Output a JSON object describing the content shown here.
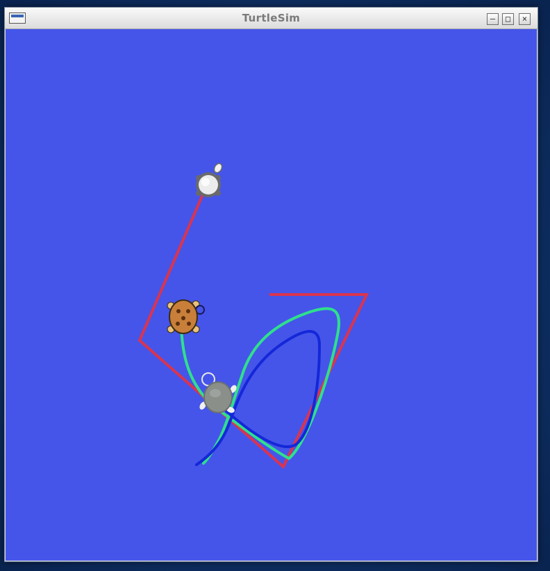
{
  "window": {
    "title": "TurtleSim",
    "controls": {
      "minimize_icon": "minimize-icon",
      "maximize_icon": "maximize-icon",
      "close_icon": "close-icon"
    }
  },
  "canvas": {
    "background_color": "#4555ea",
    "trail_colors": {
      "red": "#d9344f",
      "green": "#2fe08c",
      "blue": "#1428d8"
    },
    "turtles": [
      {
        "name": "white-turtle",
        "color": "#e6e6e6"
      },
      {
        "name": "orange-turtle",
        "color": "#c87f3a"
      },
      {
        "name": "gray-turtle",
        "color": "#8a8f8a"
      }
    ]
  }
}
